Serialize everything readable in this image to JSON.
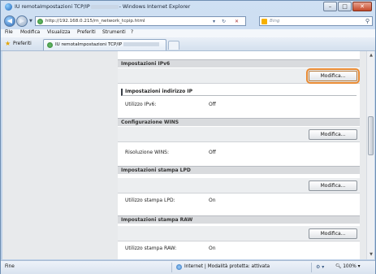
{
  "window": {
    "title_prefix": "IU remotaImpostazioni TCP/IP",
    "title_suffix": "- Windows Internet Explorer"
  },
  "address": {
    "url_host": "http://192.168.0.215",
    "url_path": "/rn_network_tcpip.html",
    "search_placeholder": "Bing"
  },
  "menu": [
    "File",
    "Modifica",
    "Visualizza",
    "Preferiti",
    "Strumenti",
    "?"
  ],
  "favorites": {
    "label": "Preferiti",
    "tab_title": "IU remotaImpostazioni TCP/IP"
  },
  "sections": [
    {
      "title": "Impostazioni IPv6",
      "button": "Modifica...",
      "subhead": "Impostazioni indirizzo IP",
      "rows": [
        {
          "label": "Utilizzo IPv6:",
          "value": "Off"
        }
      ]
    },
    {
      "title": "Configurazione WINS",
      "button": "Modifica...",
      "rows": [
        {
          "label": "Risoluzione WINS:",
          "value": "Off"
        }
      ]
    },
    {
      "title": "Impostazioni stampa LPD",
      "button": "Modifica...",
      "rows": [
        {
          "label": "Utilizzo stampa LPD:",
          "value": "On"
        }
      ]
    },
    {
      "title": "Impostazioni stampa RAW",
      "button": "Modifica...",
      "rows": [
        {
          "label": "Utilizzo stampa RAW:",
          "value": "On"
        }
      ]
    }
  ],
  "status": {
    "left": "Fine",
    "zone": "Internet | Modalità protetta: attivata",
    "zoom": "100%"
  },
  "colors": {
    "focus_outline": "#e98a32",
    "section_header": "#d9dbde",
    "page_bg": "#e8eaec"
  },
  "icons": [
    "ie-icon",
    "back-icon",
    "forward-icon",
    "refresh-icon",
    "stop-icon",
    "bing-icon",
    "search-icon",
    "star-icon",
    "globe-icon",
    "minimize-icon",
    "maximize-icon",
    "close-icon"
  ]
}
